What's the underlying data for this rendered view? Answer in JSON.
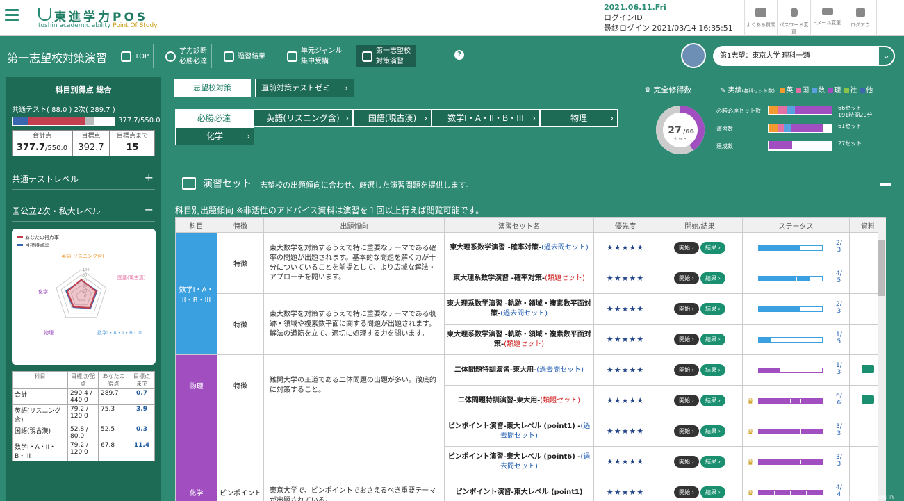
{
  "header": {
    "logo_title": "東進学力POS",
    "logo_sub_a": "toshin academic ability ",
    "logo_sub_b": "Point Of Study",
    "date": "2021.06.11.Fri",
    "login_id": "ログインID",
    "last_login": "最終ログイン 2021/03/14 16:35:51",
    "buttons": [
      {
        "label": "よくある質問",
        "icon": "faq-icon"
      },
      {
        "label": "パスワード変更",
        "icon": "key-icon"
      },
      {
        "label": "eメール変更",
        "icon": "mail-icon"
      },
      {
        "label": "ログアウ",
        "icon": "lock-icon"
      }
    ]
  },
  "subheader": {
    "page_title": "第一志望校対策演習",
    "nav": [
      {
        "label": "TOP",
        "icon": "home-icon"
      },
      {
        "label": "学力診断\n必勝必達",
        "icon": "search-icon"
      },
      {
        "label": "過習結果",
        "icon": "document-icon"
      },
      {
        "label": "単元ジャンル\n集中受講",
        "icon": "image-icon"
      },
      {
        "label": "第一志望校\n対策演習",
        "icon": "target-icon"
      }
    ],
    "help": "?",
    "goal": "第1志望：東京大学 理科一類"
  },
  "left": {
    "title": "科目別得点 総合",
    "sub": "共通テスト( 88.0 ) 2次( 289.7 )",
    "bar_text": "377.7/550.0",
    "totals": [
      {
        "h": "合計点",
        "v": "377.7",
        "u": "/550.0"
      },
      {
        "h": "目標点",
        "v": "392.7",
        "u": ""
      },
      {
        "h": "目標点まで",
        "v": "15",
        "u": ""
      }
    ],
    "acc1": "共通テストレベル",
    "acc1_sign": "+",
    "acc2": "国公立2次・私大レベル",
    "acc2_sign": "−",
    "radar": {
      "legend_you": "あなたの得点率",
      "legend_target": "目標得点率",
      "labels": [
        "英語(リスニング含)",
        "国語(現古漢)",
        "数学I・A・II・B・III",
        "物理",
        "化学"
      ],
      "you": [
        0.62,
        0.58,
        0.55,
        0.5,
        0.56
      ],
      "target": [
        0.6,
        0.62,
        0.58,
        0.52,
        0.6
      ],
      "ticks": [
        "100",
        "80",
        "60",
        "40",
        "20",
        "0"
      ]
    },
    "table_headers": [
      "科目",
      "目標点/配点",
      "あなたの得点",
      "目標点まで"
    ],
    "table_rows": [
      [
        "合計",
        "290.4 / 440.0",
        "289.7",
        "0.7"
      ],
      [
        "英語(リスニング含)",
        "79.2 / 120.0",
        "75.3",
        "3.9"
      ],
      [
        "国語(現古漢)",
        "52.8 / 80.0",
        "52.5",
        "0.3"
      ],
      [
        "数学I・A・II・B・III",
        "79.2 / 120.0",
        "67.8",
        "11.4"
      ]
    ]
  },
  "tabs": {
    "goal": "志望校対策",
    "seminar": "直前対策テストゼミ"
  },
  "subjects": [
    "必勝必達",
    "英語(リスニング含)",
    "国語(現古漢)",
    "数学I・A・II・B・III",
    "物理",
    "化学"
  ],
  "progress": {
    "title": "完全修得数",
    "donut_num": "27",
    "donut_den": "/66",
    "donut_unit": "セット",
    "donut_fraction": 0.41,
    "jisseki": "実績",
    "jisseki_sub": "(各科セット数)",
    "legend": [
      {
        "l": "英",
        "c": "#f19a30"
      },
      {
        "l": "国",
        "c": "#e36fa3"
      },
      {
        "l": "数",
        "c": "#5aa0e0"
      },
      {
        "l": "理",
        "c": "#a04ec0"
      },
      {
        "l": "社",
        "c": "#8bc34a"
      },
      {
        "l": "他",
        "c": "#3b66b0"
      }
    ],
    "rows": [
      {
        "label": "必勝必達セット数",
        "value": "66セット",
        "sub": "191時間20分",
        "segs": [
          0.14,
          0.15,
          0.12,
          0.59
        ]
      },
      {
        "label": "演習数",
        "value": "61セット",
        "sub": "",
        "segs": [
          0.15,
          0.1,
          0.1,
          0.52
        ]
      },
      {
        "label": "達成数",
        "value": "27セット",
        "sub": "",
        "segs": [
          0,
          0,
          0,
          0.38
        ]
      }
    ]
  },
  "ensyu": {
    "title": "演習セット",
    "desc": "志望校の出題傾向に合わせ、厳選した演習問題を提供します。"
  },
  "note": "科目別出題傾向 ※非活性のアドバイス資料は演習を１回以上行えば閲覧可能です。",
  "table": {
    "headers": [
      "科目",
      "特徴",
      "出題傾向",
      "演習セット名",
      "優先度",
      "開始/結果",
      "ステータス",
      "資料"
    ],
    "subjects": {
      "math": "数学I・A・II・B・III",
      "physics": "物理",
      "chem": "化学"
    },
    "features": {
      "tokucho": "特徴",
      "pinpoint": "ピンポイント"
    },
    "trends": [
      "東大数学を対策するうえで特に重要なテーマである確率の問題が出題されます。基本的な問題を解く力が十分についていることを前提として、より広域な解法・アプローチを問います。",
      "東大数学を対策するうえで特に重要なテーマである軌跡・領域や複素数平面に関する問題が出題されます。解法の道筋を立て、適切に処理する力を問います。",
      "難関大学の王道である二体問題の出題が多い。徹底的に対策すること。",
      "東京大学で、ピンポイントでおさえるべき重要テーマが出題されている。"
    ],
    "rows": [
      {
        "name": "東大理系数学演習 -確率対策-",
        "tag": "(過去問セット)",
        "tagtype": "p",
        "stars": "★★★★★",
        "done": 2,
        "total": 3,
        "color": "b",
        "crown": false,
        "book": false
      },
      {
        "name": "東大理系数学演習 -確率対策-",
        "tag": "(類題セット)",
        "tagtype": "r",
        "stars": "★★★★★",
        "done": 4,
        "total": 5,
        "color": "b",
        "crown": false,
        "book": false
      },
      {
        "name": "東大理系数学演習 -軌跡・領域・複素数平面対策-",
        "tag": "(過去問セット)",
        "tagtype": "p",
        "stars": "★★★★★",
        "done": 2,
        "total": 3,
        "color": "b",
        "crown": false,
        "book": false
      },
      {
        "name": "東大理系数学演習 -軌跡・領域・複素数平面対策-",
        "tag": "(類題セット)",
        "tagtype": "r",
        "stars": "★★★★★",
        "done": 1,
        "total": 5,
        "color": "b",
        "crown": false,
        "book": false
      },
      {
        "name": "二体問題特訓演習-東大用-",
        "tag": "(過去問セット)",
        "tagtype": "p",
        "stars": "★★★★★",
        "done": 1,
        "total": 3,
        "color": "p",
        "crown": false,
        "book": true
      },
      {
        "name": "二体問題特訓演習-東大用-",
        "tag": "(類題セット)",
        "tagtype": "r",
        "stars": "★★★★★",
        "done": 6,
        "total": 6,
        "color": "p",
        "crown": true,
        "book": true
      },
      {
        "name": "ピンポイント演習-東大レベル (point1) -",
        "tag": "(過去問セット)",
        "tagtype": "p",
        "stars": "★★★★★",
        "done": 3,
        "total": 3,
        "color": "p",
        "crown": true,
        "book": false
      },
      {
        "name": "ピンポイント演習-東大レベル (point6) -",
        "tag": "(過去問セット)",
        "tagtype": "p",
        "stars": "★★★★★",
        "done": 3,
        "total": 3,
        "color": "p",
        "crown": true,
        "book": false
      },
      {
        "name": "ピンポイント演習-東大レベル (point1)",
        "tag": "",
        "tagtype": "p",
        "stars": "★★★★★",
        "done": 4,
        "total": 4,
        "color": "p",
        "crown": true,
        "book": false
      }
    ],
    "start": "開始",
    "result": "結果"
  },
  "copyright": "Copyright (C) 2015 Nagase Bros In"
}
